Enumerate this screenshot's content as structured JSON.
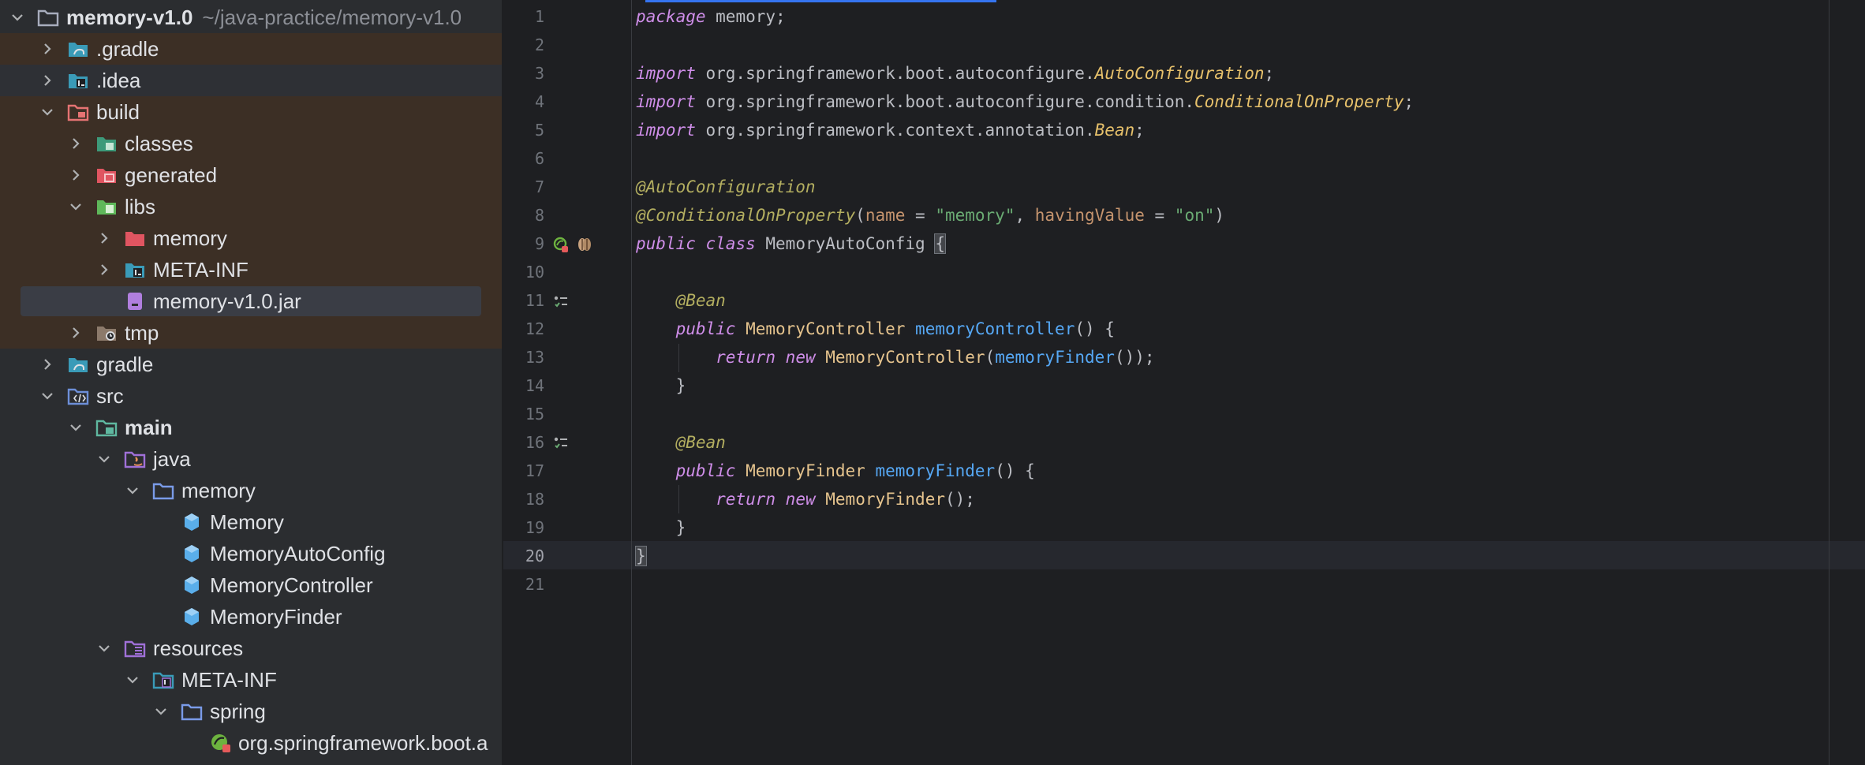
{
  "project": {
    "root_name": "memory-v1.0",
    "root_path": "~/java-practice/memory-v1.0",
    "items": [
      {
        "label": "memory-v1.0",
        "depth": 0
      },
      {
        "label": ".gradle"
      },
      {
        "label": ".idea"
      },
      {
        "label": "build"
      },
      {
        "label": "classes"
      },
      {
        "label": "generated"
      },
      {
        "label": "libs"
      },
      {
        "label": "memory"
      },
      {
        "label": "META-INF"
      },
      {
        "label": "memory-v1.0.jar"
      },
      {
        "label": "tmp"
      },
      {
        "label": "gradle"
      },
      {
        "label": "src"
      },
      {
        "label": "main"
      },
      {
        "label": "java"
      },
      {
        "label": "memory"
      },
      {
        "label": "Memory"
      },
      {
        "label": "MemoryAutoConfig"
      },
      {
        "label": "MemoryController"
      },
      {
        "label": "MemoryFinder"
      },
      {
        "label": "resources"
      },
      {
        "label": "META-INF"
      },
      {
        "label": "spring"
      },
      {
        "label": "org.springframework.boot.a"
      }
    ]
  },
  "editor": {
    "line_numbers": [
      "1",
      "2",
      "3",
      "4",
      "5",
      "6",
      "7",
      "8",
      "9",
      "10",
      "11",
      "12",
      "13",
      "14",
      "15",
      "16",
      "17",
      "18",
      "19",
      "20",
      "21"
    ],
    "current_line": "20",
    "code": {
      "l1_kw": "package",
      "l1_rest": " memory;",
      "l3_kw": "import",
      "l3_pkg": " org.springframework.boot.autoconfigure.",
      "l3_cls": "AutoConfiguration",
      "l3_end": ";",
      "l4_kw": "import",
      "l4_pkg": " org.springframework.boot.autoconfigure.condition.",
      "l4_cls": "ConditionalOnProperty",
      "l4_end": ";",
      "l5_kw": "import",
      "l5_pkg": " org.springframework.context.annotation.",
      "l5_cls": "Bean",
      "l5_end": ";",
      "l7_ann": "@AutoConfiguration",
      "l8_ann": "@ConditionalOnProperty",
      "l8_p1": "(",
      "l8_n1": "name",
      "l8_eq1": " = ",
      "l8_s1": "\"memory\"",
      "l8_c": ", ",
      "l8_n2": "havingValue",
      "l8_eq2": " = ",
      "l8_s2": "\"on\"",
      "l8_p2": ")",
      "l9_kw1": "public",
      "l9_kw2": "class",
      "l9_cls": "MemoryAutoConfig",
      "l9_brace": "{",
      "l11_ann": "@Bean",
      "l12_kw": "public",
      "l12_type": "MemoryController",
      "l12_fn": "memoryController",
      "l12_end": "() {",
      "l13_kw1": "return",
      "l13_kw2": "new",
      "l13_cls": "MemoryController",
      "l13_p": "(",
      "l13_fn": "memoryFinder",
      "l13_end": "());",
      "l14": "}",
      "l16_ann": "@Bean",
      "l17_kw": "public",
      "l17_type": "MemoryFinder",
      "l17_fn": "memoryFinder",
      "l17_end": "() {",
      "l18_kw1": "return",
      "l18_kw2": "new",
      "l18_cls": "MemoryFinder",
      "l18_end": "();",
      "l19": "}",
      "l20": "}"
    }
  }
}
